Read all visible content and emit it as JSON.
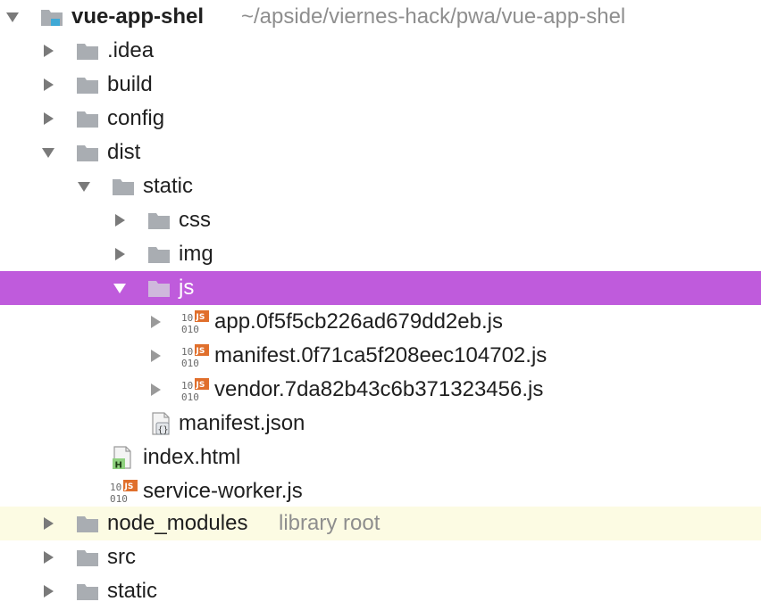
{
  "project": {
    "name": "vue-app-shel",
    "path": "~/apside/viernes-hack/pwa/vue-app-shel"
  },
  "colors": {
    "selection": "#bf5bdc",
    "library_row": "#fcfbe3",
    "folder": "#a9adb2",
    "js_badge": "#e06f2c",
    "html_badge": "#5cb85c"
  },
  "rows": [
    {
      "label": "vue-app-shel",
      "hint": "~/apside/viernes-hack/pwa/vue-app-shel",
      "icon": "project-folder-icon",
      "expanded": true
    },
    {
      "label": ".idea",
      "icon": "folder-icon",
      "expanded": false
    },
    {
      "label": "build",
      "icon": "folder-icon",
      "expanded": false
    },
    {
      "label": "config",
      "icon": "folder-icon",
      "expanded": false
    },
    {
      "label": "dist",
      "icon": "folder-icon",
      "expanded": true
    },
    {
      "label": "static",
      "icon": "folder-icon",
      "expanded": true
    },
    {
      "label": "css",
      "icon": "folder-icon",
      "expanded": false
    },
    {
      "label": "img",
      "icon": "folder-icon",
      "expanded": false
    },
    {
      "label": "js",
      "icon": "folder-icon",
      "expanded": true,
      "selected": true
    },
    {
      "label": "app.0f5f5cb226ad679dd2eb.js",
      "icon": "js-file-icon",
      "expanded": false
    },
    {
      "label": "manifest.0f71ca5f208eec104702.js",
      "icon": "js-file-icon",
      "expanded": false
    },
    {
      "label": "vendor.7da82b43c6b371323456.js",
      "icon": "js-file-icon",
      "expanded": false
    },
    {
      "label": "manifest.json",
      "icon": "json-file-icon"
    },
    {
      "label": "index.html",
      "icon": "html-file-icon"
    },
    {
      "label": "service-worker.js",
      "icon": "js-file-icon"
    },
    {
      "label": "node_modules",
      "hint": "library root",
      "icon": "folder-icon",
      "expanded": false
    },
    {
      "label": "src",
      "icon": "folder-icon",
      "expanded": false
    },
    {
      "label": "static",
      "icon": "folder-icon",
      "expanded": false
    }
  ]
}
